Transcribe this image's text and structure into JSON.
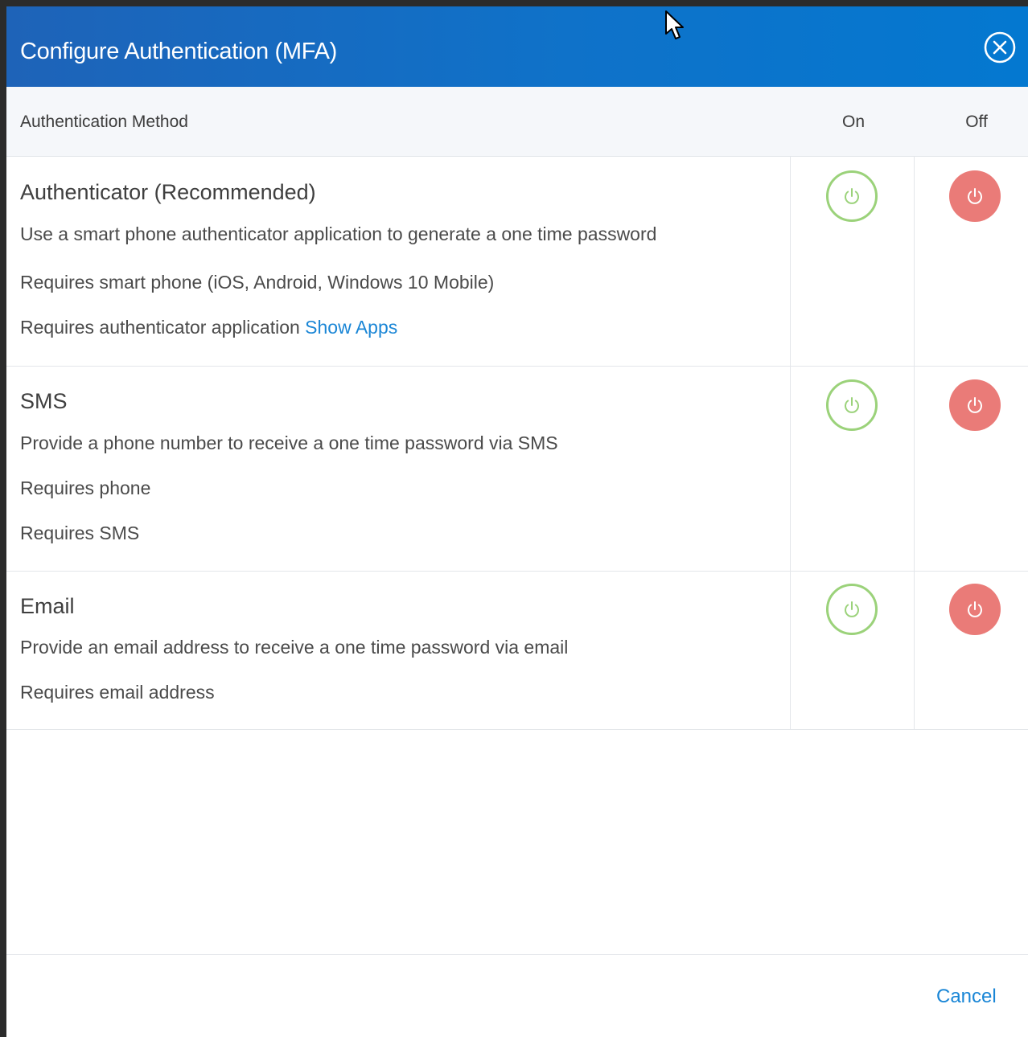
{
  "dialog": {
    "title": "Configure Authentication (MFA)"
  },
  "columns": {
    "method": "Authentication Method",
    "on": "On",
    "off": "Off"
  },
  "methods": [
    {
      "title": "Authenticator (Recommended)",
      "lines": [
        "Use a smart phone authenticator application to generate a one time password",
        "Requires smart phone (iOS, Android, Windows 10 Mobile)",
        "Requires authenticator application"
      ],
      "link": "Show Apps"
    },
    {
      "title": "SMS",
      "lines": [
        "Provide a phone number to receive a one time password via SMS",
        "Requires phone",
        "Requires SMS"
      ]
    },
    {
      "title": "Email",
      "lines": [
        "Provide an email address to receive a one time password via email",
        "Requires email address"
      ]
    }
  ],
  "footer": {
    "cancel_label": "Cancel"
  },
  "icons": {
    "close": "close-circle-icon",
    "on": "power-icon",
    "off": "power-icon",
    "cursor": "mouse-pointer-icon"
  },
  "colors": {
    "header_bg": "#0f72c9",
    "on_ring": "#9bd27a",
    "off_fill": "#ea7b78",
    "link": "#1a86d6"
  }
}
